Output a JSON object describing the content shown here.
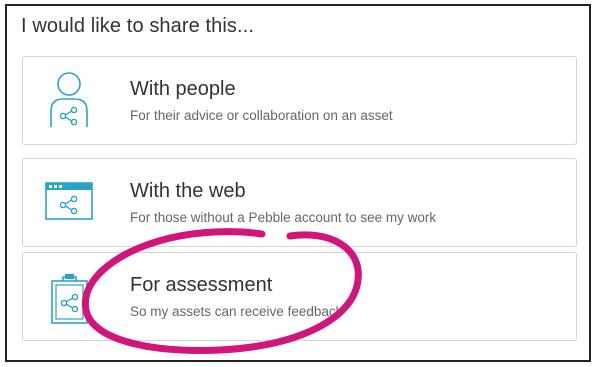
{
  "heading": "I would like to share this...",
  "options": [
    {
      "title": "With people",
      "description": "For their advice or collaboration on an asset",
      "icon": "person-share-icon"
    },
    {
      "title": "With the web",
      "description": "For those without a Pebble account to see my work",
      "icon": "browser-share-icon"
    },
    {
      "title": "For assessment",
      "description": "So my assets can receive feedback",
      "icon": "clipboard-share-icon"
    }
  ],
  "colors": {
    "icon_accent": "#2aa3c9",
    "annotation": "#d1157a",
    "border": "#d4d4d4",
    "title_text": "#333333",
    "description_text": "#666666"
  }
}
